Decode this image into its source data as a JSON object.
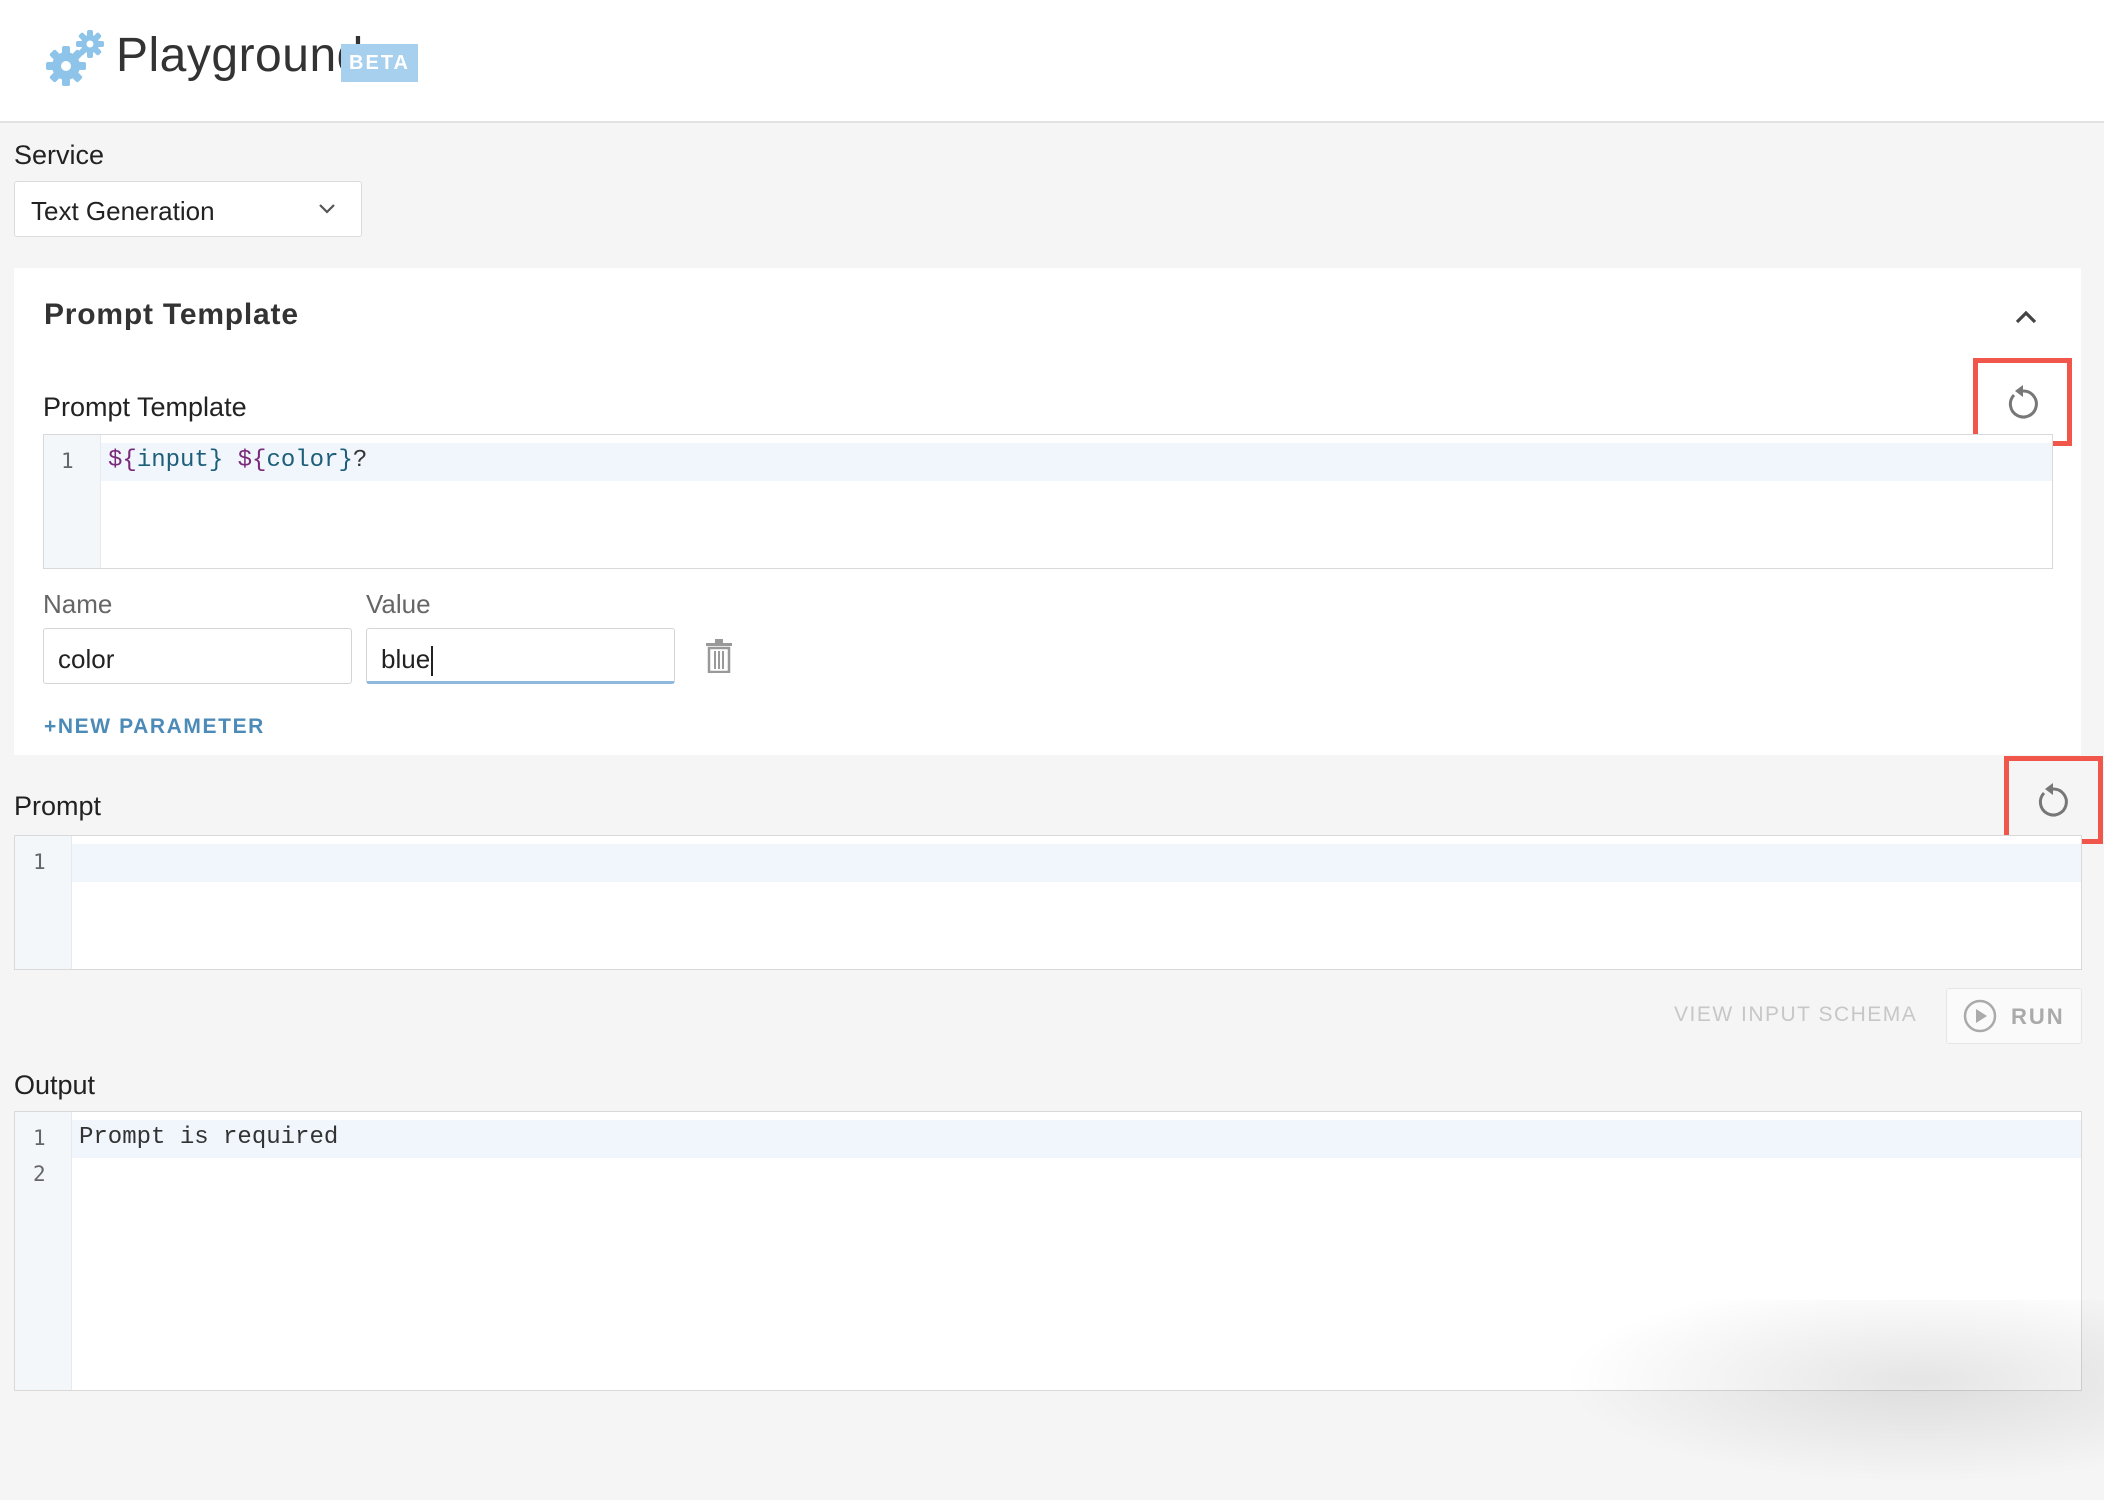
{
  "header": {
    "title": "Playground",
    "badge": "BETA",
    "logo_icon": "gears-icon"
  },
  "service": {
    "label": "Service",
    "selected": "Text Generation"
  },
  "prompt_template_section": {
    "title": "Prompt Template",
    "field_label": "Prompt Template",
    "editor_lines": [
      {
        "number": "1",
        "text": "${input} ${color}?"
      }
    ],
    "parameters": {
      "name_label": "Name",
      "value_label": "Value",
      "rows": [
        {
          "name": "color",
          "value": "blue"
        }
      ],
      "add_label": "+NEW PARAMETER"
    }
  },
  "prompt": {
    "label": "Prompt",
    "editor_lines": [
      {
        "number": "1",
        "text": ""
      }
    ]
  },
  "actions": {
    "view_schema_label": "VIEW INPUT SCHEMA",
    "run_label": "RUN"
  },
  "output": {
    "label": "Output",
    "editor_lines": [
      {
        "number": "1",
        "text": "Prompt is required"
      },
      {
        "number": "2",
        "text": ""
      }
    ]
  },
  "colors": {
    "accent": "#4c8bb8",
    "highlight": "#f0574a",
    "badge": "#a7cfee"
  }
}
